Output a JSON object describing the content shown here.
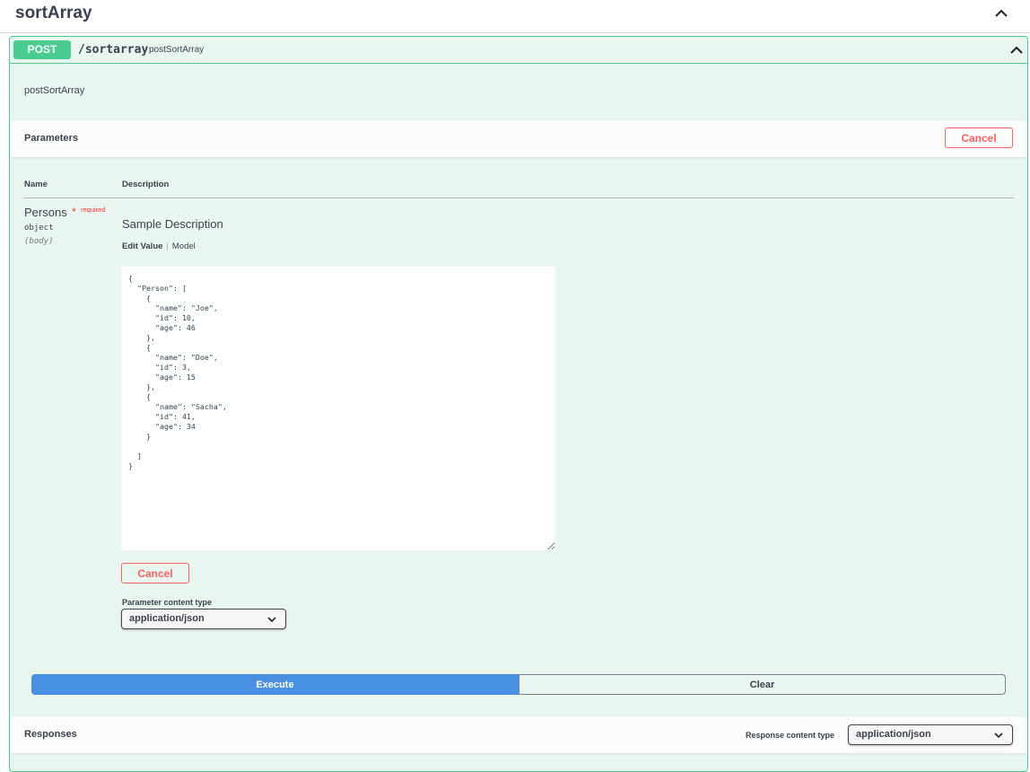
{
  "tag": {
    "title": "sortArray",
    "chevron_icon": "chevron-up-icon"
  },
  "operation": {
    "method": "POST",
    "path": "/sortarray",
    "operation_id": "postSortArray",
    "description": "postSortArray",
    "chevron_icon": "chevron-up-icon"
  },
  "parameters": {
    "title": "Parameters",
    "cancel_label": "Cancel",
    "col_name": "Name",
    "col_description": "Description",
    "param": {
      "name": "Persons",
      "required_star": "*",
      "required_text": "required",
      "type": "object",
      "in": "(body)",
      "description": "Sample Description",
      "tab_edit": "Edit Value",
      "tab_separator": "|",
      "tab_model": "Model",
      "body_value": "{\n  \"Person\": [\n    {\n      \"name\": \"Joe\",\n      \"id\": 10,\n      \"age\": 46\n    },\n    {\n      \"name\": \"Doe\",\n      \"id\": 3,\n      \"age\": 15\n    },\n    {\n      \"name\": \"Sacha\",\n      \"id\": 41,\n      \"age\": 34\n    }\n\n  ]\n}",
      "cancel_label": "Cancel",
      "content_type_label": "Parameter content type",
      "content_type_value": "application/json"
    }
  },
  "actions": {
    "execute_label": "Execute",
    "clear_label": "Clear"
  },
  "responses": {
    "title": "Responses",
    "content_type_label": "Response content type",
    "content_type_value": "application/json"
  },
  "colors": {
    "post": "#49cc90",
    "post_bg": "#e8f6ef",
    "execute": "#4990e2",
    "cancel": "#ff6060"
  }
}
